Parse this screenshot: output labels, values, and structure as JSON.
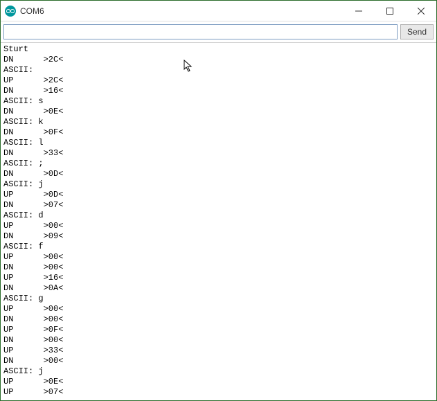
{
  "window": {
    "title": "COM6"
  },
  "toolbar": {
    "input_value": "",
    "input_placeholder": "",
    "send_label": "Send"
  },
  "console_lines": [
    "Sturt",
    "DN      >2C<",
    "ASCII:",
    "UP      >2C<",
    "DN      >16<",
    "ASCII: s",
    "DN      >0E<",
    "ASCII: k",
    "DN      >0F<",
    "ASCII: l",
    "DN      >33<",
    "ASCII: ;",
    "DN      >0D<",
    "ASCII: j",
    "UP      >0D<",
    "DN      >07<",
    "ASCII: d",
    "UP      >00<",
    "DN      >09<",
    "ASCII: f",
    "UP      >00<",
    "DN      >00<",
    "UP      >16<",
    "DN      >0A<",
    "ASCII: g",
    "UP      >00<",
    "DN      >00<",
    "UP      >0F<",
    "DN      >00<",
    "UP      >33<",
    "DN      >00<",
    "ASCII: j",
    "UP      >0E<",
    "UP      >07<"
  ]
}
